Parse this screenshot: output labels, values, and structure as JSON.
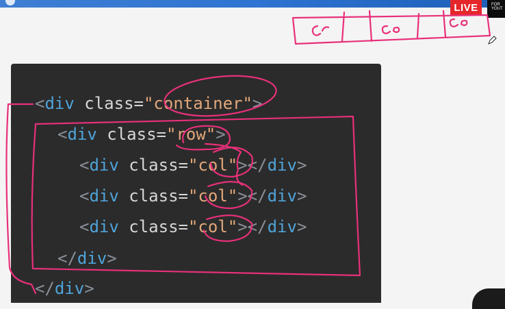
{
  "header": {
    "live_label": "LIVE",
    "logo_line1": "FOR",
    "logo_line2": "YOUT"
  },
  "code": {
    "lines": [
      {
        "open": "<",
        "tag": "div",
        "attr": "class",
        "eq": "=",
        "value": "\"container\"",
        "close": ">"
      },
      {
        "open": "<",
        "tag": "div",
        "attr": "class",
        "eq": "=",
        "value": "\"row\"",
        "close": ">"
      },
      {
        "open": "<",
        "tag": "div",
        "attr": "class",
        "eq": "=",
        "value": "\"col\"",
        "close": "></",
        "tag2": "div",
        "close2": ">"
      },
      {
        "open": "<",
        "tag": "div",
        "attr": "class",
        "eq": "=",
        "value": "\"col\"",
        "close": "></",
        "tag2": "div",
        "close2": ">"
      },
      {
        "open": "<",
        "tag": "div",
        "attr": "class",
        "eq": "=",
        "value": "\"col\"",
        "close": "></",
        "tag2": "div",
        "close2": ">"
      },
      {
        "open": "</",
        "tag": "div",
        "close": ">"
      },
      {
        "open": "</",
        "tag": "div",
        "close": ">"
      }
    ]
  },
  "annotation": {
    "ink_color": "#e8307a",
    "sketch_labels": [
      "Cr",
      "Co",
      "Co"
    ]
  }
}
